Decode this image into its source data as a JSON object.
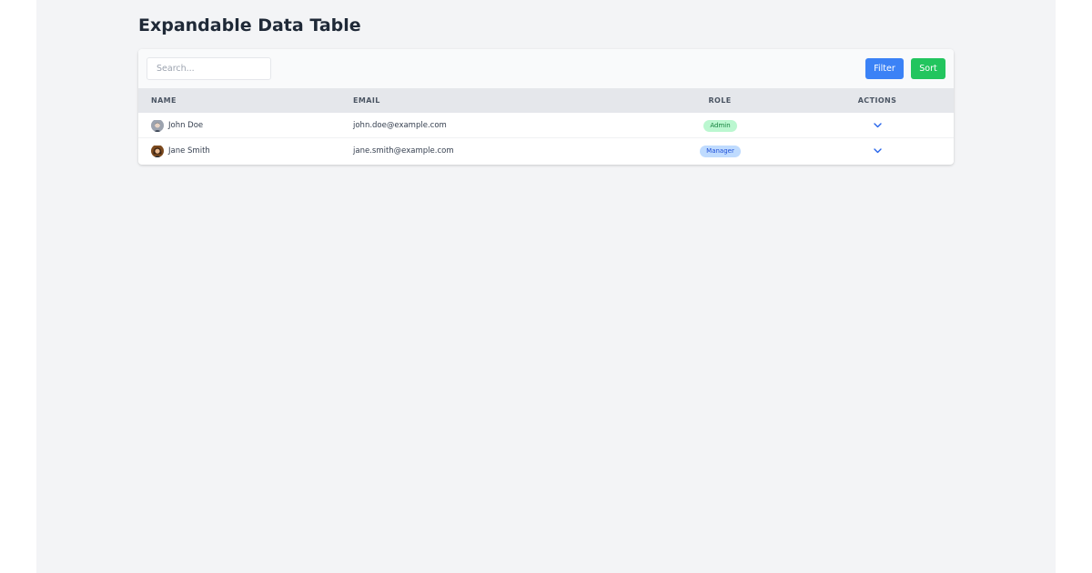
{
  "page": {
    "title": "Expandable Data Table"
  },
  "toolbar": {
    "search_placeholder": "Search...",
    "search_value": "",
    "filter_label": "Filter",
    "sort_label": "Sort"
  },
  "table": {
    "columns": [
      "NAME",
      "EMAIL",
      "ROLE",
      "ACTIONS"
    ],
    "rows": [
      {
        "name": "John Doe",
        "email": "john.doe@example.com",
        "role": "Admin",
        "role_bg": "#bbf7d0",
        "role_fg": "#15803d",
        "action_icon": "chevron-down-icon"
      },
      {
        "name": "Jane Smith",
        "email": "jane.smith@example.com",
        "role": "Manager",
        "role_bg": "#bfdbfe",
        "role_fg": "#1d4ed8",
        "action_icon": "chevron-down-icon"
      }
    ]
  },
  "colors": {
    "filter_button": "#3b82f6",
    "sort_button": "#22c55e",
    "chevron": "#2563eb",
    "page_background": "#f3f4f6",
    "header_background": "#e5e7eb"
  }
}
